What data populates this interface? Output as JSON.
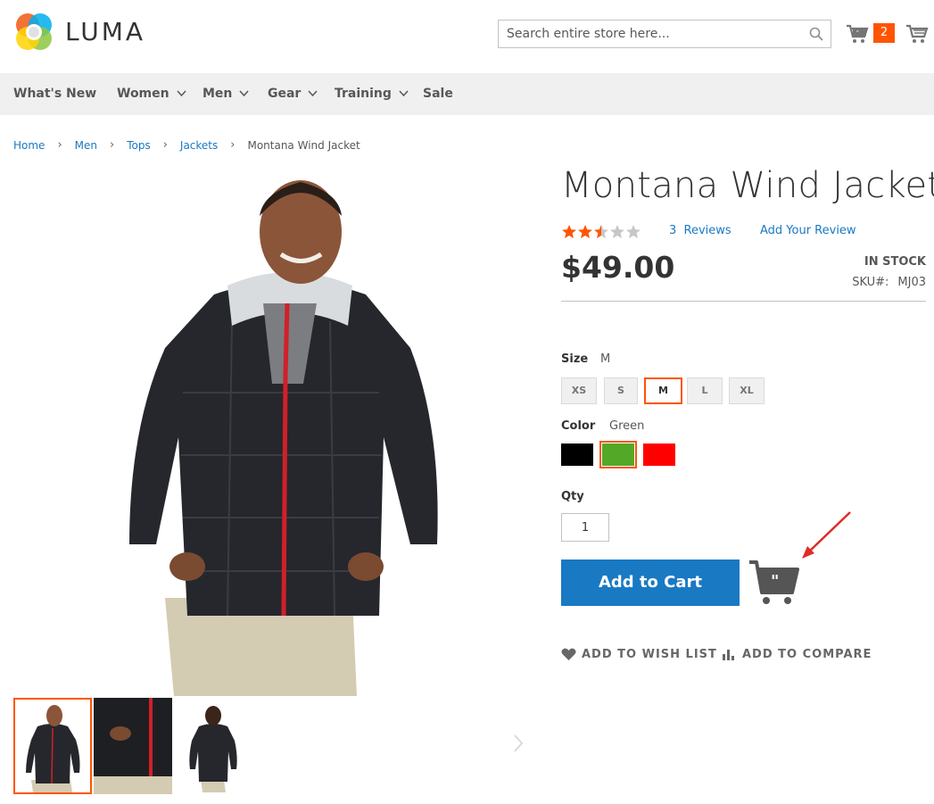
{
  "header": {
    "logo_text": "LUMA",
    "search_placeholder": "Search entire store here...",
    "cart_count": "2"
  },
  "nav": {
    "items": [
      {
        "label": "What's New",
        "has_dropdown": false
      },
      {
        "label": "Women",
        "has_dropdown": true
      },
      {
        "label": "Men",
        "has_dropdown": true
      },
      {
        "label": "Gear",
        "has_dropdown": true
      },
      {
        "label": "Training",
        "has_dropdown": true
      },
      {
        "label": "Sale",
        "has_dropdown": false
      }
    ]
  },
  "breadcrumb": {
    "items": [
      "Home",
      "Men",
      "Tops",
      "Jackets"
    ],
    "current": "Montana Wind Jacket"
  },
  "product": {
    "title": "Montana Wind Jacket",
    "rating_stars": 2.5,
    "rating_max": 5,
    "reviews_count": "3",
    "reviews_label": "Reviews",
    "add_review_label": "Add Your Review",
    "price": "$49.00",
    "stock": "IN STOCK",
    "sku_label": "SKU#:",
    "sku": "MJ03"
  },
  "options": {
    "size_label": "Size",
    "size_selected": "M",
    "sizes": [
      "XS",
      "S",
      "M",
      "L",
      "XL"
    ],
    "color_label": "Color",
    "color_selected": "Green",
    "colors": [
      {
        "name": "Black",
        "hex": "#000000"
      },
      {
        "name": "Green",
        "hex": "#53a828"
      },
      {
        "name": "Red",
        "hex": "#ff0000"
      }
    ]
  },
  "purchase": {
    "qty_label": "Qty",
    "qty_value": "1",
    "add_to_cart_label": "Add to Cart",
    "wish_label": "ADD TO WISH LIST",
    "compare_label": "ADD TO COMPARE"
  },
  "colors": {
    "accent": "#ff5501",
    "primary_button": "#1979c3",
    "link": "#1979c3",
    "star_filled": "#ff5501",
    "star_empty": "#c7c7c7",
    "annotation_arrow": "#e02b27"
  }
}
